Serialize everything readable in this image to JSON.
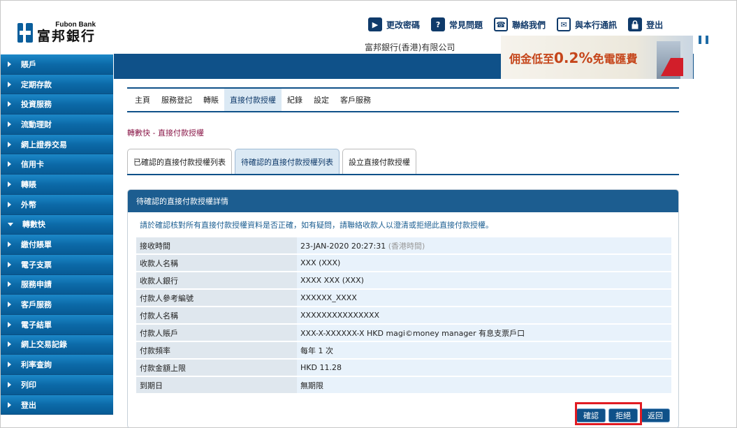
{
  "header": {
    "logo_en": "Fubon Bank",
    "logo_zh": "富邦銀行",
    "company": "富邦銀行(香港)有限公司",
    "links": [
      {
        "icon": "play-icon",
        "glyph": "▶",
        "label": "更改密碼"
      },
      {
        "icon": "question-icon",
        "glyph": "?",
        "label": "常見問題"
      },
      {
        "icon": "phone-icon",
        "glyph": "☎",
        "label": "聯絡我們"
      },
      {
        "icon": "mail-icon",
        "glyph": "✉",
        "label": "與本行通訊"
      },
      {
        "icon": "lock-icon",
        "glyph": "🔒",
        "label": "登出"
      }
    ],
    "pause_glyph": "❚❚"
  },
  "ad": {
    "prefix": "佣金低至",
    "rate": "0.2%",
    "suffix": "免電匯費"
  },
  "sidebar": {
    "items": [
      {
        "label": "賬戶",
        "expanded": false
      },
      {
        "label": "定期存款",
        "expanded": false
      },
      {
        "label": "投資服務",
        "expanded": false
      },
      {
        "label": "流動理財",
        "expanded": false
      },
      {
        "label": "網上證券交易",
        "expanded": false
      },
      {
        "label": "信用卡",
        "expanded": false
      },
      {
        "label": "轉賬",
        "expanded": false
      },
      {
        "label": "外幣",
        "expanded": false
      },
      {
        "label": "轉數快",
        "expanded": true
      },
      {
        "label": "繳付賬單",
        "expanded": false
      },
      {
        "label": "電子支票",
        "expanded": false
      },
      {
        "label": "服務申請",
        "expanded": false
      },
      {
        "label": "客戶服務",
        "expanded": false
      },
      {
        "label": "電子結單",
        "expanded": false
      },
      {
        "label": "網上交易記錄",
        "expanded": false
      },
      {
        "label": "利率查詢",
        "expanded": false
      },
      {
        "label": "列印",
        "expanded": false
      },
      {
        "label": "登出",
        "expanded": false
      }
    ]
  },
  "topmenu": {
    "items": [
      "主頁",
      "服務登記",
      "轉賬",
      "直接付款授權",
      "紀錄",
      "設定",
      "客戶服務"
    ],
    "active_index": 3
  },
  "breadcrumb": "轉數快 - 直接付款授權",
  "tabs": {
    "items": [
      "已確認的直接付款授權列表",
      "待確認的直接付款授權列表",
      "設立直接付款授權"
    ],
    "active_index": 1
  },
  "panel": {
    "title": "待確認的直接付款授權詳情",
    "notice": "請於確認核對所有直接付款授權資料是否正確，如有疑問，請聯絡收款人以澄清或拒絕此直接付款授權。",
    "rows": [
      {
        "label": "接收時間",
        "value": "23-JAN-2020 20:27:31",
        "note": "(香港時間)"
      },
      {
        "label": "收款人名稱",
        "value": "XXX (XXX)",
        "note": ""
      },
      {
        "label": "收款人銀行",
        "value": "XXXX XXX (XXX)",
        "note": ""
      },
      {
        "label": "付款人參考編號",
        "value": "XXXXXX_XXXX",
        "note": ""
      },
      {
        "label": "付款人名稱",
        "value": "XXXXXXXXXXXXXXX",
        "note": ""
      },
      {
        "label": "付款人賬戶",
        "value": "XXX-X-XXXXXX-X  HKD magi©money manager 有息支票戶口",
        "note": ""
      },
      {
        "label": "付款頻率",
        "value": "每年 1 次",
        "note": ""
      },
      {
        "label": "付款金額上限",
        "value": "HKD   11.28",
        "note": ""
      },
      {
        "label": "到期日",
        "value": "無期限",
        "note": ""
      }
    ],
    "buttons": {
      "confirm": "確認",
      "reject": "拒絕",
      "back": "返回"
    }
  }
}
